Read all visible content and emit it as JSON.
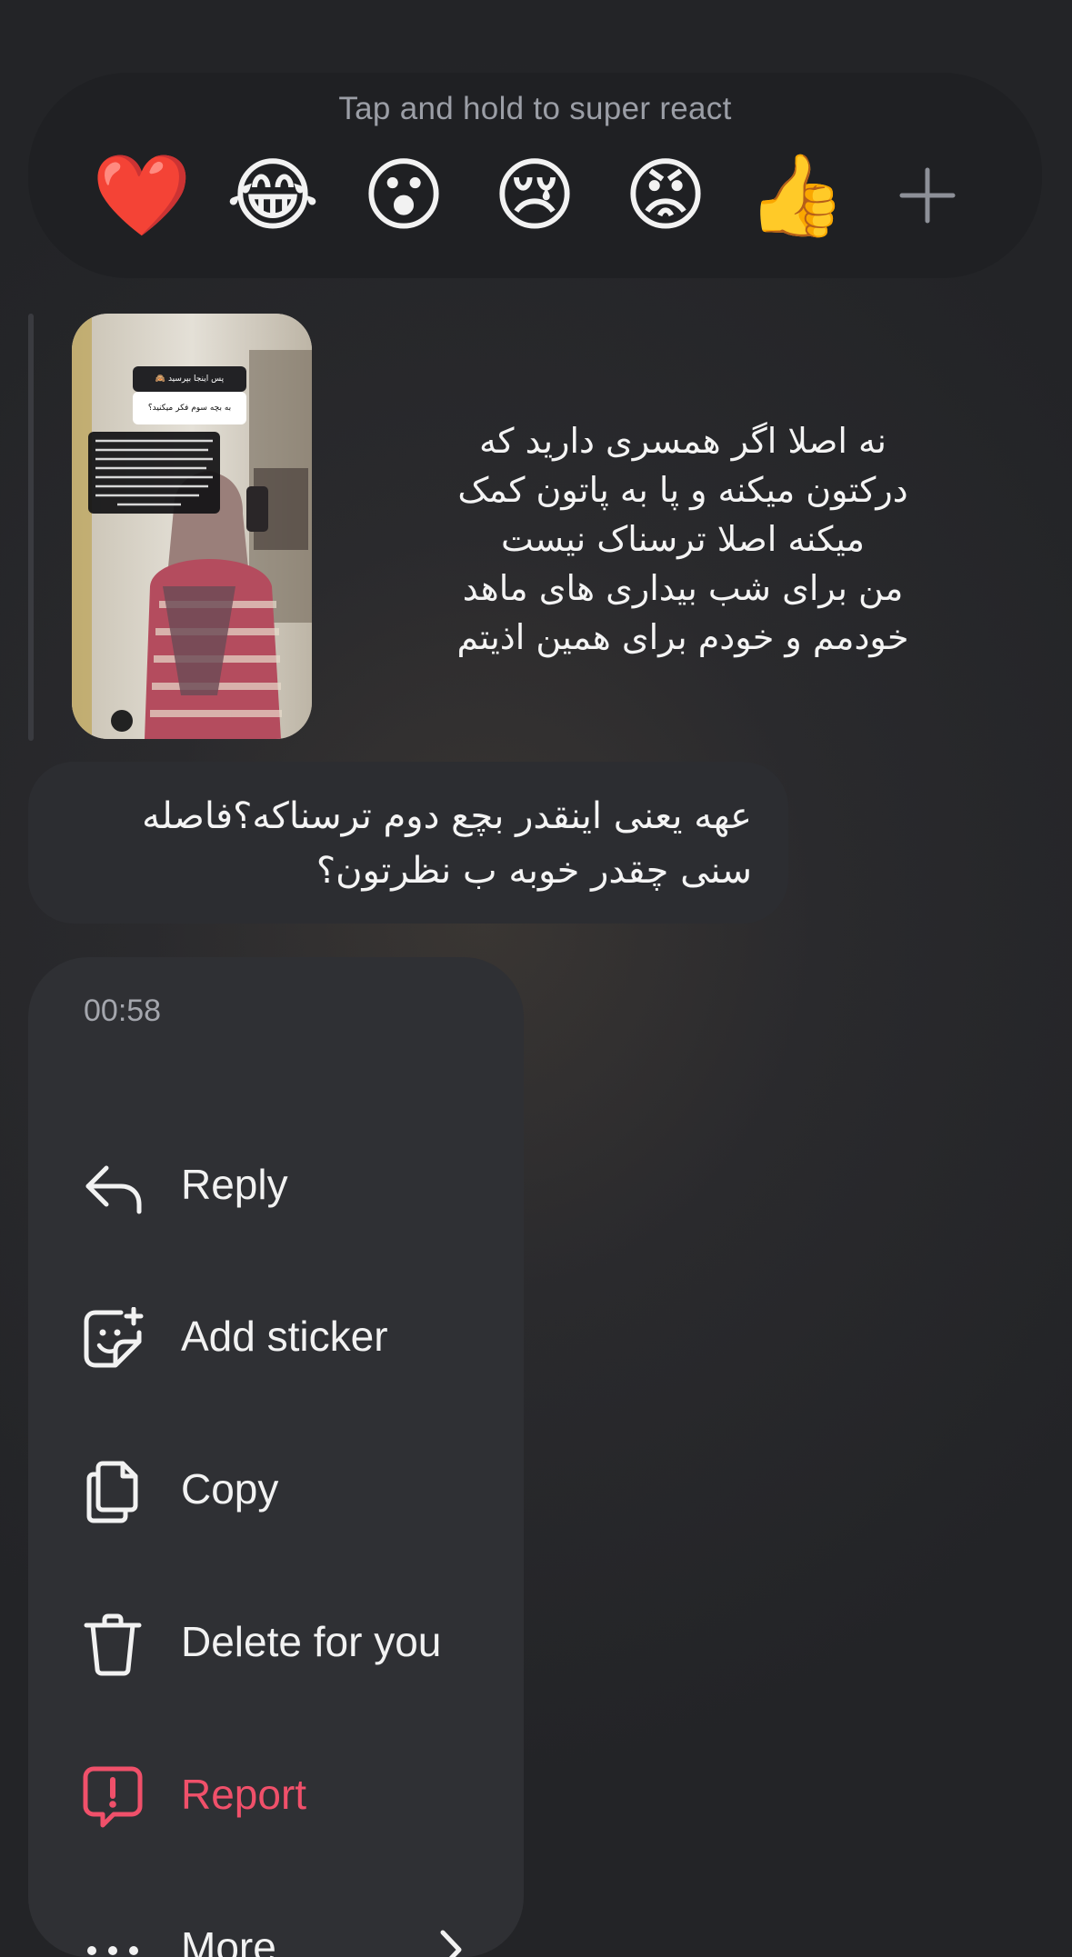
{
  "reaction_bar": {
    "hint": "Tap and hold to super react",
    "emojis": [
      {
        "icon": "red-heart",
        "glyph": "❤️"
      },
      {
        "icon": "tears-of-joy",
        "glyph": "😂"
      },
      {
        "icon": "surprised-face",
        "glyph": "😮"
      },
      {
        "icon": "crying-face",
        "glyph": "😢"
      },
      {
        "icon": "angry-face",
        "glyph": "😡"
      },
      {
        "icon": "thumbs-up",
        "glyph": "👍"
      }
    ],
    "more_icon": "plus-icon"
  },
  "story_reply": {
    "text": "نه اصلا اگر همسری دارید که\nدرکتون میکنه و پا به پاتون کمک\nمیکنه اصلا ترسناک نیست\nمن برای شب بیداری های ماهد\nخودمم و خودم برای همین اذیتم",
    "thumbnail_title": "پس اینجا بپرسید 🙈",
    "thumbnail_question": "به بچه سوم فکر میکنید؟"
  },
  "selected_message": {
    "text": "عهه یعنی اینقدر بچع دوم ترسناکه؟فاصله\nسنی چقدر خوبه ب نظرتون؟"
  },
  "menu": {
    "time": "00:58",
    "items": [
      {
        "label": "Reply",
        "icon": "reply-icon"
      },
      {
        "label": "Add sticker",
        "icon": "add-sticker-icon"
      },
      {
        "label": "Copy",
        "icon": "copy-icon"
      },
      {
        "label": "Delete for you",
        "icon": "trash-icon"
      },
      {
        "label": "Report",
        "icon": "report-icon",
        "color": "#f0506a"
      },
      {
        "label": "More",
        "icon": "more-dots-icon"
      }
    ]
  },
  "colors": {
    "background": "#27282b",
    "reaction_bar": "#1f2023",
    "menu": "#2f3034",
    "danger": "#f0506a"
  }
}
